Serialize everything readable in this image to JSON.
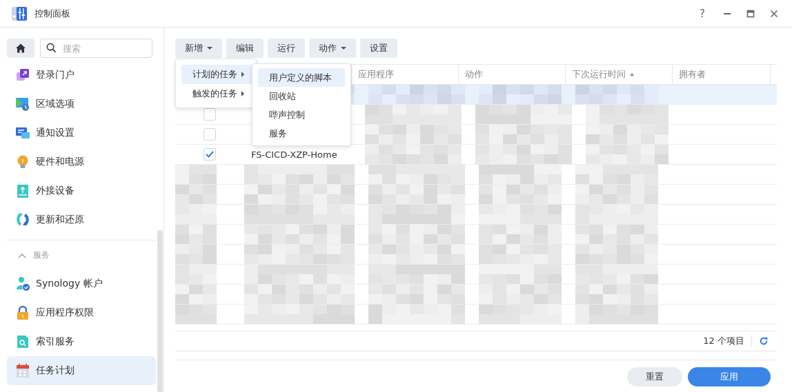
{
  "window": {
    "title": "控制面板",
    "help": "?"
  },
  "sidebar": {
    "search": {
      "placeholder": "搜索"
    },
    "items": [
      {
        "label": "登录门户",
        "selected": false
      },
      {
        "label": "区域选项",
        "selected": false
      },
      {
        "label": "通知设置",
        "selected": false
      },
      {
        "label": "硬件和电源",
        "selected": false
      },
      {
        "label": "外接设备",
        "selected": false
      },
      {
        "label": "更新和还原",
        "selected": false
      }
    ],
    "group": {
      "label": "服务",
      "expanded": true,
      "items": [
        {
          "label": "Synology 帐户",
          "selected": false
        },
        {
          "label": "应用程序权限",
          "selected": false
        },
        {
          "label": "索引服务",
          "selected": false
        },
        {
          "label": "任务计划",
          "selected": true
        }
      ]
    }
  },
  "toolbar": [
    {
      "label": "新增",
      "dropdown": true
    },
    {
      "label": "编辑",
      "dropdown": false
    },
    {
      "label": "运行",
      "dropdown": false
    },
    {
      "label": "动作",
      "dropdown": true
    },
    {
      "label": "设置",
      "dropdown": false
    }
  ],
  "menu": {
    "items": [
      {
        "label": "计划的任务",
        "selected": true
      },
      {
        "label": "触发的任务",
        "selected": false
      }
    ],
    "submenu": [
      {
        "label": "用户定义的脚本",
        "selected": true
      },
      {
        "label": "回收站",
        "selected": false
      },
      {
        "label": "哔声控制",
        "selected": false
      },
      {
        "label": "服务",
        "selected": false
      }
    ]
  },
  "table": {
    "columns": [
      {
        "label": "应用程序",
        "sorted": false
      },
      {
        "label": "动作",
        "sorted": false
      },
      {
        "label": "下次运行时间",
        "sorted": true
      },
      {
        "label": "拥有者",
        "sorted": false
      }
    ],
    "rows": [
      {
        "kind": "masked",
        "selected": true
      },
      {
        "kind": "plain",
        "selected": false,
        "checked": false
      },
      {
        "kind": "plain",
        "selected": false,
        "checked": false
      },
      {
        "kind": "plain",
        "selected": false,
        "checked": true,
        "name": "FS-CICD-XZP-Home"
      },
      {
        "kind": "masked",
        "selected": false
      },
      {
        "kind": "masked",
        "selected": false
      },
      {
        "kind": "masked",
        "selected": false
      },
      {
        "kind": "masked",
        "selected": false
      },
      {
        "kind": "masked",
        "selected": false
      },
      {
        "kind": "masked",
        "selected": false
      },
      {
        "kind": "masked",
        "selected": false
      },
      {
        "kind": "masked",
        "selected": false
      }
    ],
    "count": "12 个项目"
  },
  "buttons": [
    {
      "label": "重置",
      "kind": "secondary"
    },
    {
      "label": "应用",
      "kind": "primary"
    }
  ]
}
